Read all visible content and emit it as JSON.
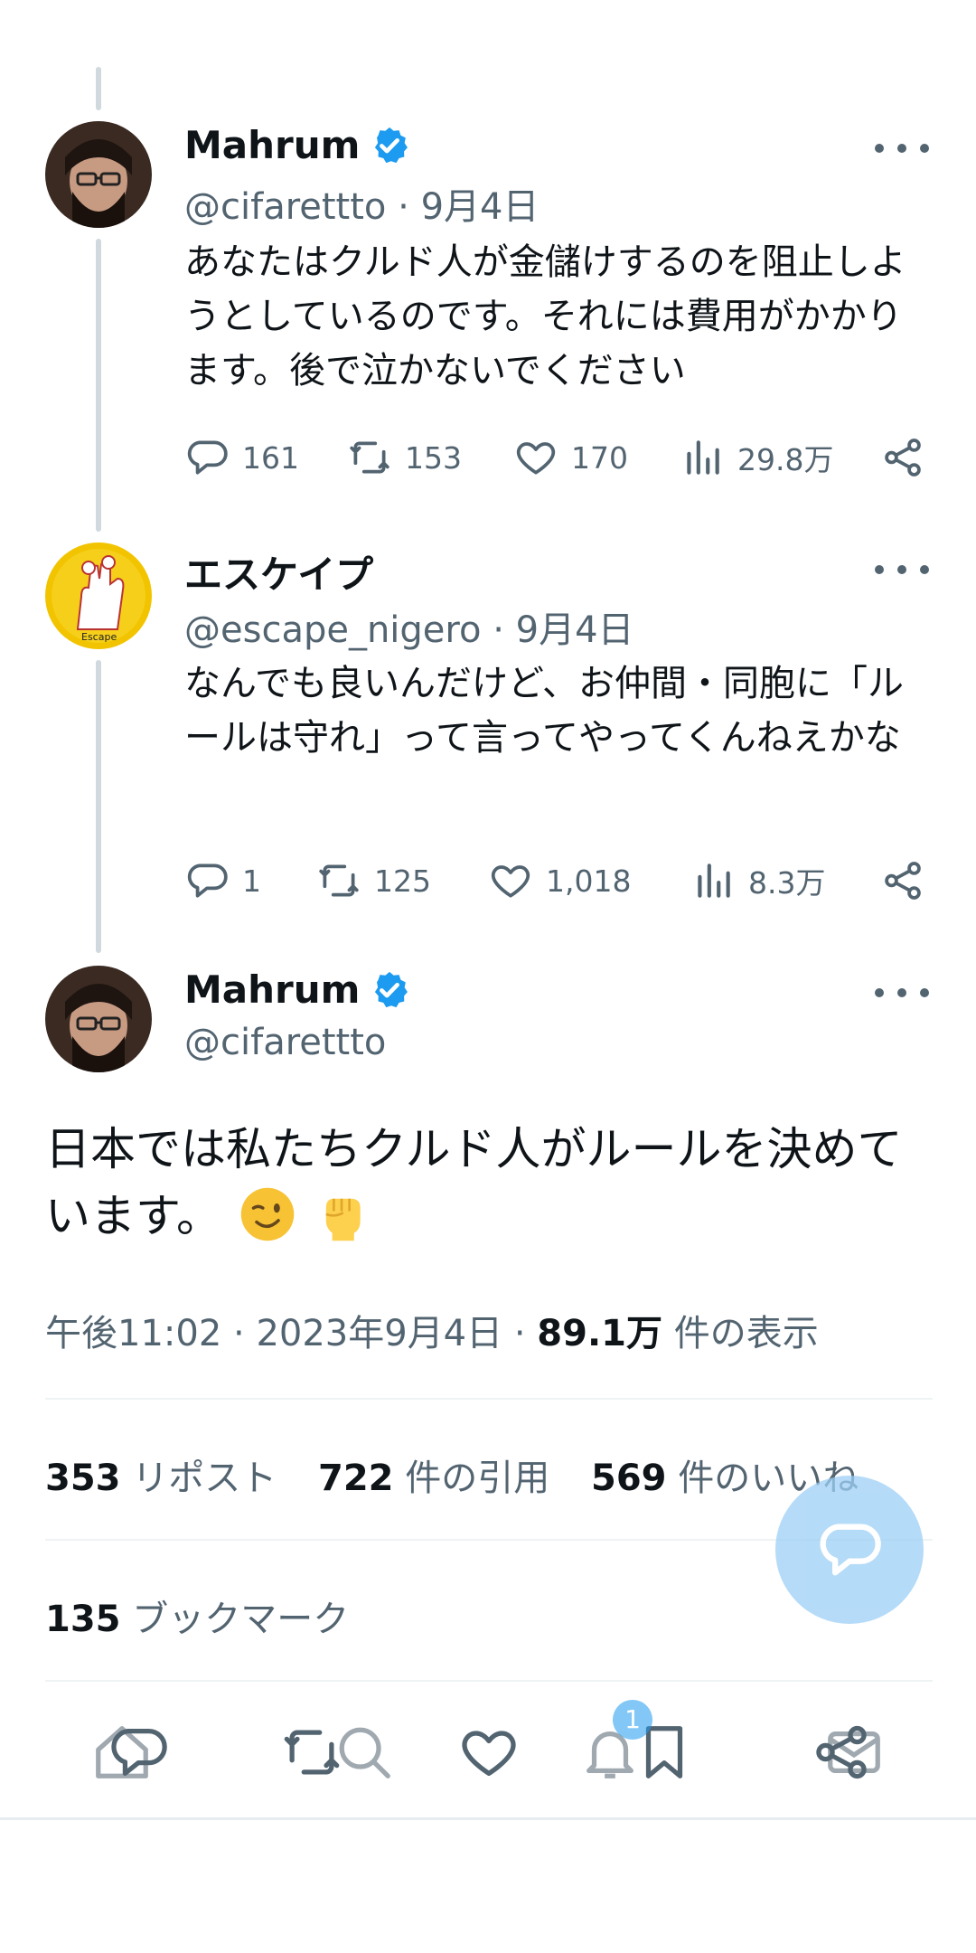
{
  "tweets": [
    {
      "name": "Mahrum",
      "verified": true,
      "handle": "@cifarettto",
      "date": "9月4日",
      "text": "あなたはクルド人が金儲けするのを阻止しようとしているのです。それには費用がかかります。後で泣かないでください",
      "replies": "161",
      "reposts": "153",
      "likes": "170",
      "views": "29.8万"
    },
    {
      "name": "エスケイプ",
      "verified": false,
      "handle": "@escape_nigero",
      "date": "9月4日",
      "text": "なんでも良いんだけど、お仲間・同胞に「ルールは守れ」って言ってやってくんねえかな",
      "replies": "1",
      "reposts": "125",
      "likes": "1,018",
      "views": "8.3万"
    }
  ],
  "main": {
    "name": "Mahrum",
    "verified": true,
    "handle": "@cifarettto",
    "text": "日本では私たちクルド人がルールを決めています。",
    "emojis": [
      "winking-face",
      "raised-fist"
    ],
    "time": "午後11:02",
    "date": "2023年9月4日",
    "views_count": "89.1万",
    "views_label": "件の表示",
    "reposts_count": "353",
    "reposts_label": "リポスト",
    "quotes_count": "722",
    "quotes_label": "件の引用",
    "likes_count": "569",
    "likes_label": "件のいいね",
    "bookmarks_count": "135",
    "bookmarks_label": "ブックマーク"
  },
  "notifications_badge": "1",
  "colors": {
    "accent": "#1d9bf0",
    "muted": "#536471",
    "text": "#0f1419",
    "fab": "#9ccff6"
  },
  "icons": [
    "reply-icon",
    "repost-icon",
    "like-icon",
    "views-icon",
    "share-icon",
    "more-icon",
    "verified-icon",
    "home-icon",
    "search-icon",
    "bell-icon",
    "mail-icon",
    "bookmark-icon"
  ]
}
